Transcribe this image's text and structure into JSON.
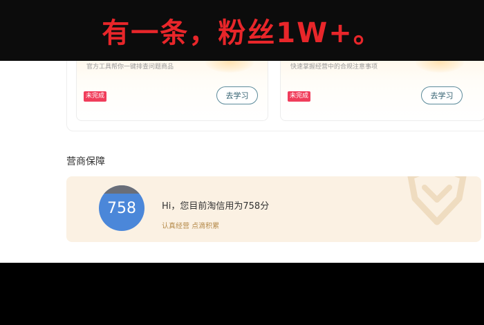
{
  "caption": {
    "text": "有一条，粉丝1W+。",
    "color": "#e8262a"
  },
  "cards": [
    {
      "description": "官方工具帮你一键排查问题商品",
      "status_badge": "未完成",
      "button_label": "去学习"
    },
    {
      "description": "快速掌握经营中的合规注意事项",
      "status_badge": "未完成",
      "button_label": "去学习"
    }
  ],
  "section": {
    "title": "营商保障"
  },
  "credit": {
    "score": "758",
    "message": "Hi，您目前淘信用为758分",
    "sub": "认真经营 点滴积累",
    "score_color": "#4b87d9"
  },
  "colors": {
    "badge": "#f03d5b",
    "credit_bg": "#fbf1e3",
    "accent_text": "#b58a4a"
  }
}
